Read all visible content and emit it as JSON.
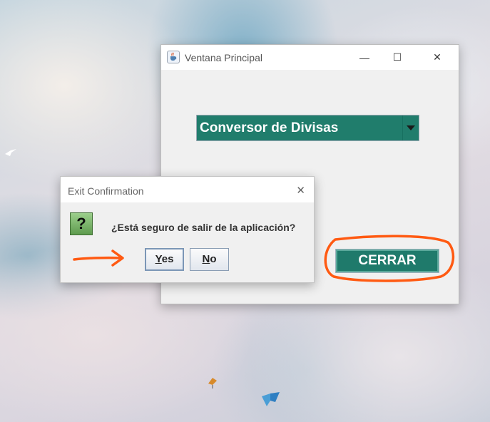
{
  "main_window": {
    "title": "Ventana Principal",
    "controls": {
      "minimize": "—",
      "maximize": "☐",
      "close": "✕"
    },
    "combo": {
      "selected": "Conversor de Divisas"
    },
    "close_button_label": "CERRAR"
  },
  "dialog": {
    "title": "Exit Confirmation",
    "close": "✕",
    "icon_text": "?",
    "message": "¿Está seguro de salir de la aplicación?",
    "yes_mnemonic": "Y",
    "yes_rest": "es",
    "no_mnemonic": "N",
    "no_rest": "o"
  },
  "annotations": {
    "color": "#ff5a12"
  },
  "colors": {
    "accent": "#207d6c",
    "window_bg": "#f0f0f0"
  }
}
